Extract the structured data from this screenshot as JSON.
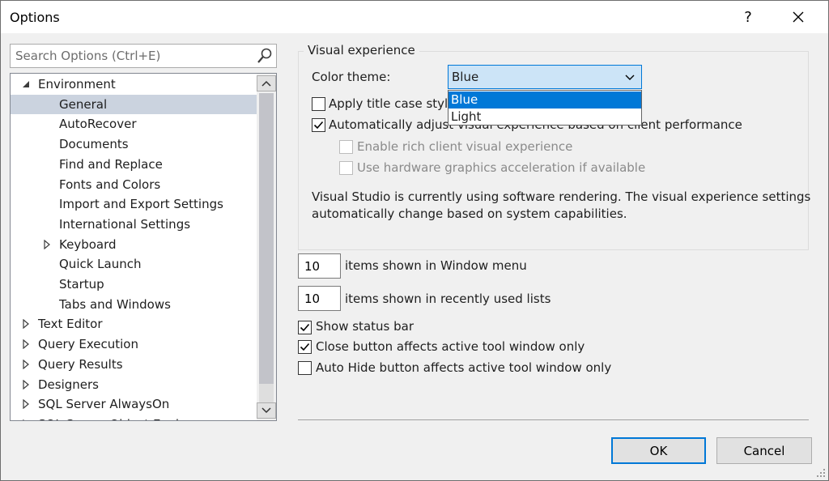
{
  "window": {
    "title": "Options",
    "help_glyph": "?",
    "close_glyph": "✕"
  },
  "search": {
    "placeholder": "Search Options (Ctrl+E)",
    "icon": "search-icon"
  },
  "tree": {
    "items": [
      {
        "label": "Environment",
        "level": 0,
        "state": "expanded"
      },
      {
        "label": "General",
        "level": 1,
        "state": "leaf",
        "selected": true
      },
      {
        "label": "AutoRecover",
        "level": 1,
        "state": "leaf"
      },
      {
        "label": "Documents",
        "level": 1,
        "state": "leaf"
      },
      {
        "label": "Find and Replace",
        "level": 1,
        "state": "leaf"
      },
      {
        "label": "Fonts and Colors",
        "level": 1,
        "state": "leaf"
      },
      {
        "label": "Import and Export Settings",
        "level": 1,
        "state": "leaf"
      },
      {
        "label": "International Settings",
        "level": 1,
        "state": "leaf"
      },
      {
        "label": "Keyboard",
        "level": 1,
        "state": "collapsed"
      },
      {
        "label": "Quick Launch",
        "level": 1,
        "state": "leaf"
      },
      {
        "label": "Startup",
        "level": 1,
        "state": "leaf"
      },
      {
        "label": "Tabs and Windows",
        "level": 1,
        "state": "leaf"
      },
      {
        "label": "Text Editor",
        "level": 0,
        "state": "collapsed"
      },
      {
        "label": "Query Execution",
        "level": 0,
        "state": "collapsed"
      },
      {
        "label": "Query Results",
        "level": 0,
        "state": "collapsed"
      },
      {
        "label": "Designers",
        "level": 0,
        "state": "collapsed"
      },
      {
        "label": "SQL Server AlwaysOn",
        "level": 0,
        "state": "collapsed"
      },
      {
        "label": "SQL Server Object Explorer",
        "level": 0,
        "state": "collapsed"
      }
    ]
  },
  "visual_experience": {
    "group_title": "Visual experience",
    "color_theme_label": "Color theme:",
    "color_theme_value": "Blue",
    "color_theme_options": [
      "Blue",
      "Light"
    ],
    "highlighted_option": "Blue",
    "apply_title_case_label": "Apply title case styling",
    "apply_title_case_checked": false,
    "auto_adjust_label": "Automatically adjust visual experience based on client performance",
    "auto_adjust_checked": true,
    "rich_client_label": "Enable rich client visual experience",
    "rich_client_checked": false,
    "rich_client_enabled": false,
    "hw_accel_label": "Use hardware graphics acceleration if available",
    "hw_accel_checked": false,
    "hw_accel_enabled": false,
    "info_line1": "Visual Studio is currently using software rendering.  The visual experience settings",
    "info_line2": "automatically change based on system capabilities."
  },
  "window_menu": {
    "value": "10",
    "label": "items shown in Window menu"
  },
  "recent_lists": {
    "value": "10",
    "label": "items shown in recently used lists"
  },
  "options": {
    "show_status_bar": {
      "label": "Show status bar",
      "checked": true
    },
    "close_button_active": {
      "label": "Close button affects active tool window only",
      "checked": true
    },
    "auto_hide_active": {
      "label": "Auto Hide button affects active tool window only",
      "checked": false
    }
  },
  "buttons": {
    "ok": "OK",
    "cancel": "Cancel"
  },
  "colors": {
    "accent": "#0078d7",
    "selection": "#cbd3df",
    "dialog_bg": "#f0f0f0"
  }
}
